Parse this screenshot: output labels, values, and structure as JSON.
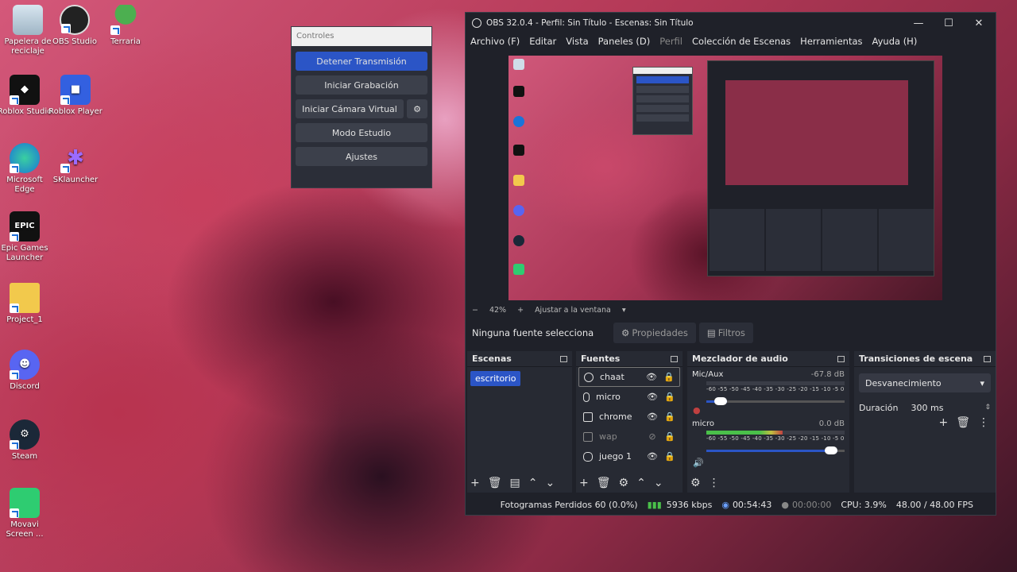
{
  "desktop": {
    "icons": [
      {
        "label": "Papelera de reciclaje",
        "icon": "recycle-bin-icon"
      },
      {
        "label": "OBS Studio",
        "icon": "obs-icon"
      },
      {
        "label": "Terraria",
        "icon": "terraria-icon"
      },
      {
        "label": "Roblox Studio",
        "icon": "roblox-studio-icon"
      },
      {
        "label": "Roblox Player",
        "icon": "roblox-player-icon"
      },
      {
        "label": "Microsoft Edge",
        "icon": "edge-icon"
      },
      {
        "label": "SKlauncher",
        "icon": "sklauncher-icon"
      },
      {
        "label": "Epic Games Launcher",
        "icon": "epic-games-icon"
      },
      {
        "label": "Project_1",
        "icon": "folder-icon"
      },
      {
        "label": "Discord",
        "icon": "discord-icon"
      },
      {
        "label": "Steam",
        "icon": "steam-icon"
      },
      {
        "label": "Movavi Screen ...",
        "icon": "movavi-icon"
      }
    ]
  },
  "controles": {
    "title": "Controles",
    "stop_stream": "Detener Transmisión",
    "start_recording": "Iniciar Grabación",
    "start_virtual_cam": "Iniciar Cámara Virtual",
    "studio_mode": "Modo Estudio",
    "settings": "Ajustes"
  },
  "obs": {
    "title": "OBS 32.0.4 - Perfil: Sin Título - Escenas: Sin Título",
    "menu": [
      "Archivo (F)",
      "Editar",
      "Vista",
      "Paneles (D)",
      "Perfil",
      "Colección de Escenas",
      "Herramientas",
      "Ayuda (H)"
    ],
    "zoom": {
      "minus": "−",
      "value": "42%",
      "plus": "+",
      "fit": "Ajustar a la ventana"
    },
    "source_bar": {
      "none_selected": "Ninguna fuente selecciona",
      "properties": "Propiedades",
      "filters": "Filtros"
    },
    "docks": {
      "scenes": {
        "title": "Escenas",
        "items": [
          "escritorio"
        ]
      },
      "sources": {
        "title": "Fuentes",
        "items": [
          {
            "name": "chaat",
            "icon": "browser-icon",
            "visible": true
          },
          {
            "name": "micro",
            "icon": "mic-icon",
            "visible": true
          },
          {
            "name": "chrome",
            "icon": "window-icon",
            "visible": true
          },
          {
            "name": "wap",
            "icon": "window-icon",
            "visible": false
          },
          {
            "name": "juego 1",
            "icon": "gamepad-icon",
            "visible": true
          }
        ]
      },
      "mixer": {
        "title": "Mezclador de audio",
        "scale": "-60 -55 -50 -45 -40 -35 -30 -25 -20 -15 -10 -5 0",
        "channels": [
          {
            "name": "Mic/Aux",
            "db": "-67.8 dB",
            "level": 0.0,
            "volume": 0.15,
            "muted": true
          },
          {
            "name": "micro",
            "db": "0.0 dB",
            "level": 0.55,
            "volume": 0.95,
            "muted": false
          }
        ]
      },
      "transitions": {
        "title": "Transiciones de escena",
        "type": "Desvanecimiento",
        "duration_label": "Duración",
        "duration": "300 ms"
      }
    },
    "status": {
      "dropped": "Fotogramas Perdidos 60 (0.0%)",
      "bitrate": "5936 kbps",
      "stream_time": "00:54:43",
      "rec_time": "00:00:00",
      "cpu": "CPU: 3.9%",
      "fps": "48.00 / 48.00 FPS"
    }
  }
}
